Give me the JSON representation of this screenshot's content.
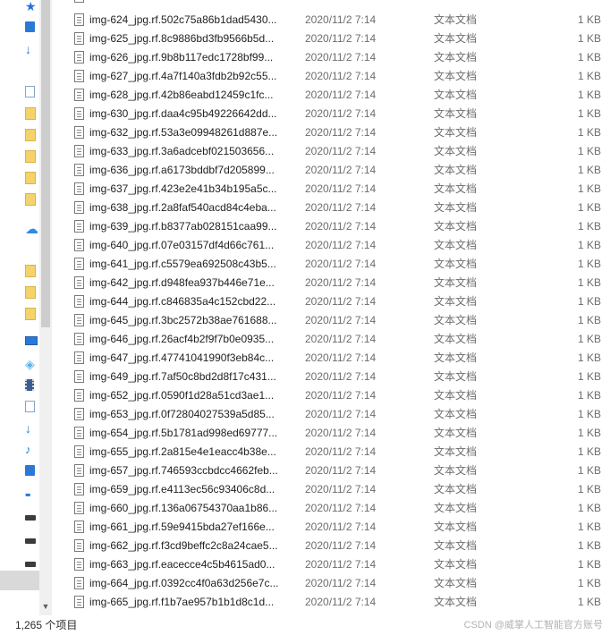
{
  "navigation": {
    "items": [
      {
        "icon": "star-icon"
      },
      {
        "icon": "desktop-icon"
      },
      {
        "icon": "download-icon"
      },
      {
        "icon": "document-icon"
      },
      {
        "icon": "folder-icon"
      },
      {
        "icon": "folder-icon"
      },
      {
        "icon": "folder-icon"
      },
      {
        "icon": "folder-icon"
      },
      {
        "icon": "folder-icon"
      },
      {
        "icon": "cloud-icon"
      },
      {
        "icon": "folder-icon"
      },
      {
        "icon": "folder-icon"
      },
      {
        "icon": "folder-icon"
      },
      {
        "icon": "this-pc-icon"
      },
      {
        "icon": "3d-objects-icon"
      },
      {
        "icon": "video-icon"
      },
      {
        "icon": "document-icon"
      },
      {
        "icon": "download-icon"
      },
      {
        "icon": "music-icon"
      },
      {
        "icon": "desktop-icon"
      },
      {
        "icon": "windows-icon"
      },
      {
        "icon": "drive-icon"
      },
      {
        "icon": "drive-icon"
      },
      {
        "icon": "drive-icon"
      }
    ]
  },
  "files": [
    {
      "name": "img-624_jpg.rf.502c75a86b1dad5430...",
      "date": "2020/11/2 7:14",
      "type": "文本文档",
      "size": "1 KB"
    },
    {
      "name": "img-625_jpg.rf.8c9886bd3fb9566b5d...",
      "date": "2020/11/2 7:14",
      "type": "文本文档",
      "size": "1 KB"
    },
    {
      "name": "img-626_jpg.rf.9b8b117edc1728bf99...",
      "date": "2020/11/2 7:14",
      "type": "文本文档",
      "size": "1 KB"
    },
    {
      "name": "img-627_jpg.rf.4a7f140a3fdb2b92c55...",
      "date": "2020/11/2 7:14",
      "type": "文本文档",
      "size": "1 KB"
    },
    {
      "name": "img-628_jpg.rf.42b86eabd12459c1fc...",
      "date": "2020/11/2 7:14",
      "type": "文本文档",
      "size": "1 KB"
    },
    {
      "name": "img-630_jpg.rf.daa4c95b49226642dd...",
      "date": "2020/11/2 7:14",
      "type": "文本文档",
      "size": "1 KB"
    },
    {
      "name": "img-632_jpg.rf.53a3e09948261d887e...",
      "date": "2020/11/2 7:14",
      "type": "文本文档",
      "size": "1 KB"
    },
    {
      "name": "img-633_jpg.rf.3a6adcebf021503656...",
      "date": "2020/11/2 7:14",
      "type": "文本文档",
      "size": "1 KB"
    },
    {
      "name": "img-636_jpg.rf.a6173bddbf7d205899...",
      "date": "2020/11/2 7:14",
      "type": "文本文档",
      "size": "1 KB"
    },
    {
      "name": "img-637_jpg.rf.423e2e41b34b195a5c...",
      "date": "2020/11/2 7:14",
      "type": "文本文档",
      "size": "1 KB"
    },
    {
      "name": "img-638_jpg.rf.2a8faf540acd84c4eba...",
      "date": "2020/11/2 7:14",
      "type": "文本文档",
      "size": "1 KB"
    },
    {
      "name": "img-639_jpg.rf.b8377ab028151caa99...",
      "date": "2020/11/2 7:14",
      "type": "文本文档",
      "size": "1 KB"
    },
    {
      "name": "img-640_jpg.rf.07e03157df4d66c761...",
      "date": "2020/11/2 7:14",
      "type": "文本文档",
      "size": "1 KB"
    },
    {
      "name": "img-641_jpg.rf.c5579ea692508c43b5...",
      "date": "2020/11/2 7:14",
      "type": "文本文档",
      "size": "1 KB"
    },
    {
      "name": "img-642_jpg.rf.d948fea937b446e71e...",
      "date": "2020/11/2 7:14",
      "type": "文本文档",
      "size": "1 KB"
    },
    {
      "name": "img-644_jpg.rf.c846835a4c152cbd22...",
      "date": "2020/11/2 7:14",
      "type": "文本文档",
      "size": "1 KB"
    },
    {
      "name": "img-645_jpg.rf.3bc2572b38ae761688...",
      "date": "2020/11/2 7:14",
      "type": "文本文档",
      "size": "1 KB"
    },
    {
      "name": "img-646_jpg.rf.26acf4b2f9f7b0e0935...",
      "date": "2020/11/2 7:14",
      "type": "文本文档",
      "size": "1 KB"
    },
    {
      "name": "img-647_jpg.rf.47741041990f3eb84c...",
      "date": "2020/11/2 7:14",
      "type": "文本文档",
      "size": "1 KB"
    },
    {
      "name": "img-649_jpg.rf.7af50c8bd2d8f17c431...",
      "date": "2020/11/2 7:14",
      "type": "文本文档",
      "size": "1 KB"
    },
    {
      "name": "img-652_jpg.rf.0590f1d28a51cd3ae1...",
      "date": "2020/11/2 7:14",
      "type": "文本文档",
      "size": "1 KB"
    },
    {
      "name": "img-653_jpg.rf.0f72804027539a5d85...",
      "date": "2020/11/2 7:14",
      "type": "文本文档",
      "size": "1 KB"
    },
    {
      "name": "img-654_jpg.rf.5b1781ad998ed69777...",
      "date": "2020/11/2 7:14",
      "type": "文本文档",
      "size": "1 KB"
    },
    {
      "name": "img-655_jpg.rf.2a815e4e1eacc4b38e...",
      "date": "2020/11/2 7:14",
      "type": "文本文档",
      "size": "1 KB"
    },
    {
      "name": "img-657_jpg.rf.746593ccbdcc4662feb...",
      "date": "2020/11/2 7:14",
      "type": "文本文档",
      "size": "1 KB"
    },
    {
      "name": "img-659_jpg.rf.e4113ec56c93406c8d...",
      "date": "2020/11/2 7:14",
      "type": "文本文档",
      "size": "1 KB"
    },
    {
      "name": "img-660_jpg.rf.136a06754370aa1b86...",
      "date": "2020/11/2 7:14",
      "type": "文本文档",
      "size": "1 KB"
    },
    {
      "name": "img-661_jpg.rf.59e9415bda27ef166e...",
      "date": "2020/11/2 7:14",
      "type": "文本文档",
      "size": "1 KB"
    },
    {
      "name": "img-662_jpg.rf.f3cd9beffc2c8a24cae5...",
      "date": "2020/11/2 7:14",
      "type": "文本文档",
      "size": "1 KB"
    },
    {
      "name": "img-663_jpg.rf.eacecce4c5b4615ad0...",
      "date": "2020/11/2 7:14",
      "type": "文本文档",
      "size": "1 KB"
    },
    {
      "name": "img-664_jpg.rf.0392cc4f0a63d256e7c...",
      "date": "2020/11/2 7:14",
      "type": "文本文档",
      "size": "1 KB"
    },
    {
      "name": "img-665_jpg.rf.f1b7ae957b1b1d8c1d...",
      "date": "2020/11/2 7:14",
      "type": "文本文档",
      "size": "1 KB"
    }
  ],
  "status": {
    "item_count": "1,265 个项目",
    "watermark": "CSDN @威掌人工智能官方账号"
  }
}
